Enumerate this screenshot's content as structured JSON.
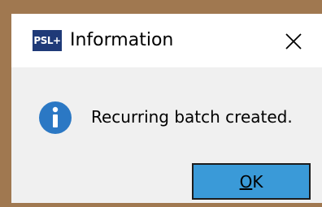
{
  "dialog": {
    "app_logo_text": "PSL+",
    "title": "Information",
    "close_icon": "close-icon",
    "message_icon": "information-icon",
    "message": "Recurring batch created.",
    "ok_button": {
      "mnemonic": "O",
      "rest": "K"
    }
  },
  "colors": {
    "backdrop": "#a07850",
    "titlebar": "#ffffff",
    "body": "#f0f0f0",
    "logo": "#1f3a78",
    "info_icon": "#2b78c4",
    "ok_button": "#3a9ad8"
  }
}
